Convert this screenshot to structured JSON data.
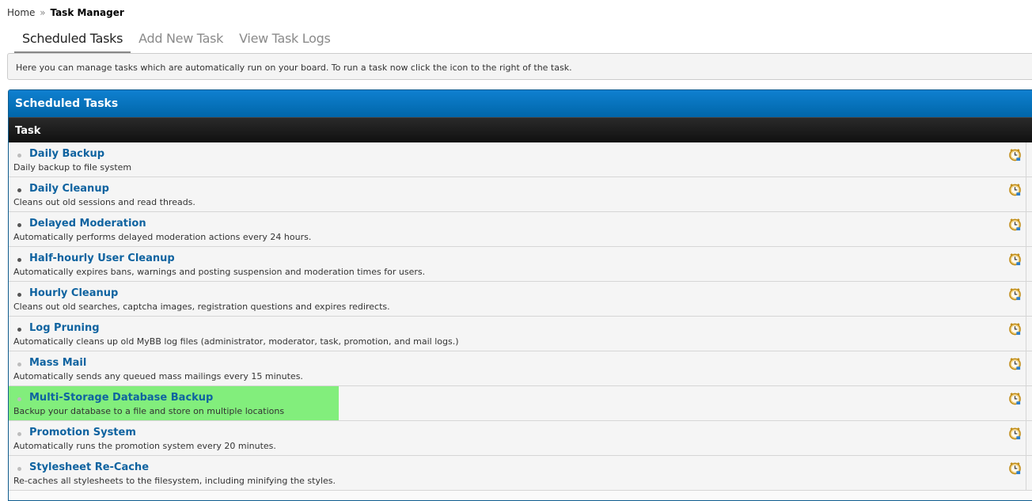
{
  "breadcrumb": {
    "home": "Home",
    "separator": "»",
    "current": "Task Manager"
  },
  "tabs": [
    {
      "label": "Scheduled Tasks",
      "active": true
    },
    {
      "label": "Add New Task",
      "active": false
    },
    {
      "label": "View Task Logs",
      "active": false
    }
  ],
  "notice": "Here you can manage tasks which are automatically run on your board. To run a task now click the icon to the right of the task.",
  "panel": {
    "title": "Scheduled Tasks",
    "column_header": "Task"
  },
  "tasks": [
    {
      "name": "Daily Backup",
      "description": "Daily backup to file system",
      "enabled": false
    },
    {
      "name": "Daily Cleanup",
      "description": "Cleans out old sessions and read threads.",
      "enabled": true
    },
    {
      "name": "Delayed Moderation",
      "description": "Automatically performs delayed moderation actions every 24 hours.",
      "enabled": true
    },
    {
      "name": "Half-hourly User Cleanup",
      "description": "Automatically expires bans, warnings and posting suspension and moderation times for users.",
      "enabled": true
    },
    {
      "name": "Hourly Cleanup",
      "description": "Cleans out old searches, captcha images, registration questions and expires redirects.",
      "enabled": true
    },
    {
      "name": "Log Pruning",
      "description": "Automatically cleans up old MyBB log files (administrator, moderator, task, promotion, and mail logs.)",
      "enabled": true
    },
    {
      "name": "Mass Mail",
      "description": "Automatically sends any queued mass mailings every 15 minutes.",
      "enabled": false
    },
    {
      "name": "Multi-Storage Database Backup",
      "description": "Backup your database to a file and store on multiple locations",
      "enabled": false,
      "highlighted": true
    },
    {
      "name": "Promotion System",
      "description": "Automatically runs the promotion system every 20 minutes.",
      "enabled": false
    },
    {
      "name": "Stylesheet Re-Cache",
      "description": "Re-caches all stylesheets to the filesystem, including minifying the styles.",
      "enabled": false
    }
  ],
  "icons": {
    "run_task": "run-task-clock-icon",
    "status": "status-dot-icon"
  },
  "colors": {
    "header_blue": "#0a74bf",
    "link_blue": "#0f63a0",
    "highlight_green": "#82ee7c"
  }
}
